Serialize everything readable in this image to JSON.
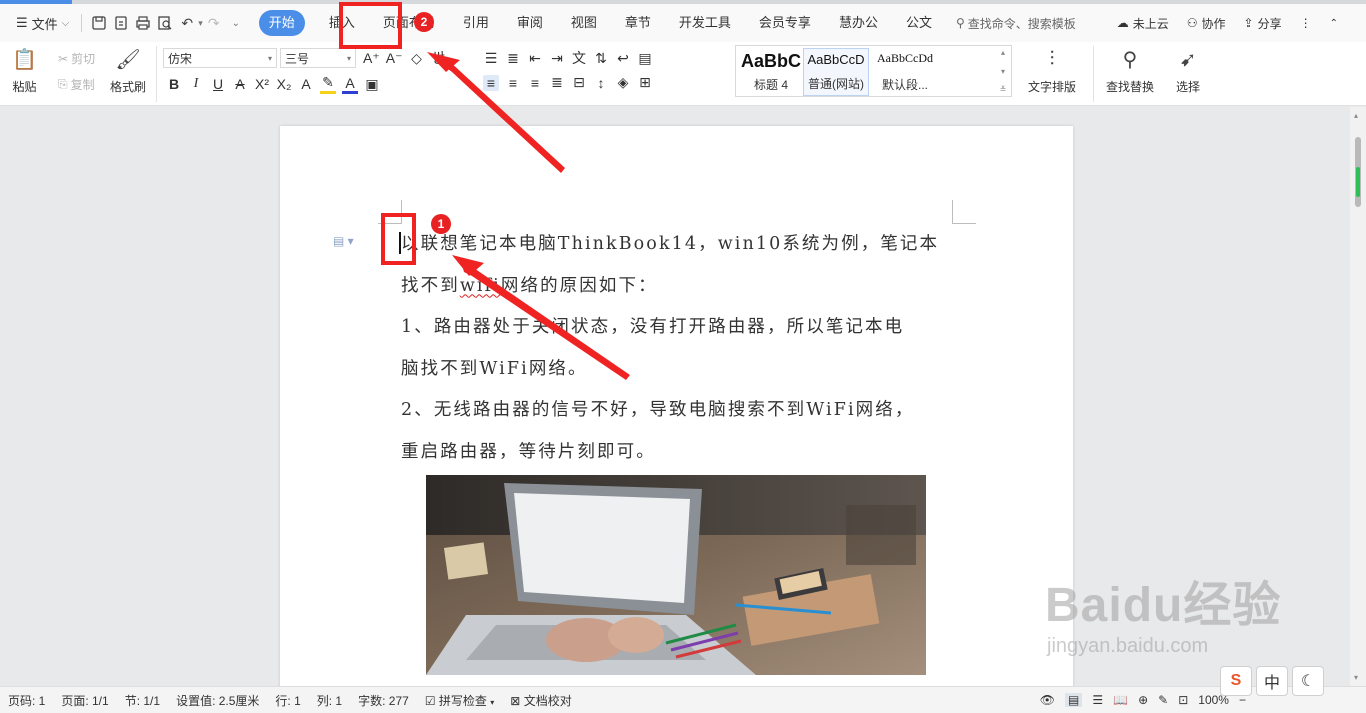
{
  "app": {
    "menu_label": "文件"
  },
  "tabs": [
    {
      "label": "开始"
    },
    {
      "label": "插入"
    },
    {
      "label": "页面布局"
    },
    {
      "label": "引用"
    },
    {
      "label": "审阅"
    },
    {
      "label": "视图"
    },
    {
      "label": "章节"
    },
    {
      "label": "开发工具"
    },
    {
      "label": "会员专享"
    },
    {
      "label": "慧办公"
    },
    {
      "label": "公文"
    }
  ],
  "search": {
    "placeholder": "查找命令、搜索模板"
  },
  "right_tools": {
    "cloud": "未上云",
    "cooperate": "协作",
    "share": "分享"
  },
  "ribbon": {
    "paste": "粘贴",
    "cut": "剪切",
    "copy": "复制",
    "format_painter": "格式刷",
    "font_name": "仿宋",
    "font_size": "三号",
    "styles": [
      {
        "sample": "AaBbC",
        "name": "标题 4"
      },
      {
        "sample": "AaBbCcD",
        "name": "普通(网站)"
      },
      {
        "sample": "AaBbCcDd",
        "name": "默认段..."
      }
    ],
    "text_layout": "文字排版",
    "find_replace": "查找替换",
    "select": "选择"
  },
  "document": {
    "lines": [
      "以联想笔记本电脑ThinkBook14，win10系统为例，笔记本",
      "1、路由器处于关闭状态，没有打开路由器，所以笔记本电",
      "脑找不到WiFi网络。",
      "2、无线路由器的信号不好，导致电脑搜索不到WiFi网络，",
      "重启路由器，等待片刻即可。"
    ],
    "line2_before": "找不到",
    "line2_wavy": "wifi",
    "line2_after": "网络的原因如下："
  },
  "status": {
    "page": "页码: 1",
    "pages": "页面: 1/1",
    "section": "节: 1/1",
    "setting": "设置值: 2.5厘米",
    "row": "行: 1",
    "col": "列: 1",
    "words": "字数: 277",
    "spell": "拼写检查",
    "proof": "文档校对",
    "zoom": "100%"
  },
  "annotations": {
    "badge1": "1",
    "badge2": "2"
  },
  "watermark": {
    "brand": "Baidu经验",
    "url": "jingyan.baidu.com"
  },
  "ime": {
    "lang": "中"
  },
  "colors": {
    "accent": "#4a8ee8",
    "annotation": "#f02323",
    "wavy": "#e02020"
  }
}
